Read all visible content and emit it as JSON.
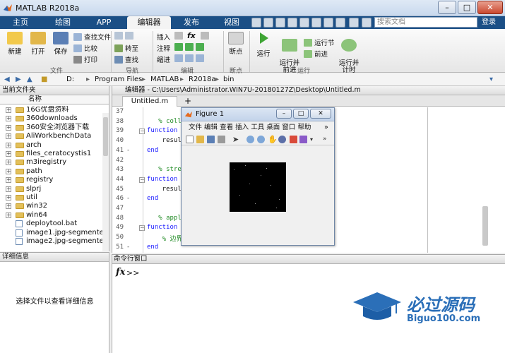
{
  "window": {
    "title": "MATLAB R2018a",
    "controls": [
      "–",
      "□",
      "✕"
    ]
  },
  "tabs": [
    {
      "label": "主页",
      "active": false
    },
    {
      "label": "绘图",
      "active": false
    },
    {
      "label": "APP",
      "active": false
    },
    {
      "label": "编辑器",
      "active": true
    },
    {
      "label": "发布",
      "active": false
    },
    {
      "label": "视图",
      "active": false
    }
  ],
  "search": {
    "placeholder": "搜索文档"
  },
  "login": "登录",
  "ribbon": {
    "file": {
      "new": "新建",
      "open": "打开",
      "save": "保存",
      "find_files": "查找文件",
      "compare": "比较",
      "print": "打印",
      "group": "文件"
    },
    "nav": {
      "goto": "转至",
      "find": "查找",
      "group": "导航"
    },
    "edit": {
      "insert": "插入",
      "comment": "注释",
      "indent": "缩进",
      "fx": "fx",
      "group": "编辑"
    },
    "breakpoints": {
      "label": "断点",
      "group": "断点"
    },
    "run": {
      "run": "运行",
      "run_advance": "运行并\n前进",
      "run_section": "运行节",
      "advance": "前进",
      "run_time": "运行并\n计时",
      "group": "运行"
    }
  },
  "address": {
    "path": [
      "D:",
      "Program Files",
      "MATLAB",
      "R2018a",
      "bin"
    ]
  },
  "file_browser": {
    "header": "当前文件夹",
    "column": "名称",
    "items": [
      {
        "name": "16G优盘资料",
        "type": "folder"
      },
      {
        "name": "360downloads",
        "type": "folder"
      },
      {
        "name": "360安全浏览器下载",
        "type": "folder"
      },
      {
        "name": "AliWorkbenchData",
        "type": "folder"
      },
      {
        "name": "arch",
        "type": "folder"
      },
      {
        "name": "files_ceratocystis1",
        "type": "folder"
      },
      {
        "name": "m3iregistry",
        "type": "folder"
      },
      {
        "name": "path",
        "type": "folder"
      },
      {
        "name": "registry",
        "type": "folder"
      },
      {
        "name": "slprj",
        "type": "folder"
      },
      {
        "name": "util",
        "type": "folder"
      },
      {
        "name": "win32",
        "type": "folder"
      },
      {
        "name": "win64",
        "type": "folder"
      },
      {
        "name": "deploytool.bat",
        "type": "file"
      },
      {
        "name": "image1.jpg-segmente...",
        "type": "file"
      },
      {
        "name": "image2.jpg-segmente...",
        "type": "file"
      }
    ]
  },
  "details": {
    "header": "详细信息",
    "empty_text": "选择文件以查看详细信息"
  },
  "editor": {
    "header": "编辑器 - C:\\Users\\Administrator.WIN7U-20180127Z\\Desktop\\Untitled.m",
    "tab": "Untitled.m",
    "add_tab": "+",
    "lines": [
      {
        "n": "37",
        "code": "",
        "kind": "plain"
      },
      {
        "n": "38",
        "code": "   % collide",
        "kind": "comment"
      },
      {
        "n": "39",
        "code": "function",
        "kind": "keyword"
      },
      {
        "n": "40",
        "code": "    resul",
        "kind": "plain"
      },
      {
        "n": "41",
        "code": "end",
        "kind": "keyword"
      },
      {
        "n": "42",
        "code": "",
        "kind": "plain"
      },
      {
        "n": "43",
        "code": "   % stream",
        "kind": "comment"
      },
      {
        "n": "44",
        "code": "function",
        "kind": "keyword"
      },
      {
        "n": "45",
        "code": "    resul",
        "kind": "plain"
      },
      {
        "n": "46",
        "code": "end",
        "kind": "keyword"
      },
      {
        "n": "47",
        "code": "",
        "kind": "plain"
      },
      {
        "n": "48",
        "code": "   % applyBo",
        "kind": "comment"
      },
      {
        "n": "49",
        "code": "function",
        "kind": "keyword"
      },
      {
        "n": "50",
        "code": "    % 边界",
        "kind": "comment"
      },
      {
        "n": "51",
        "code": "end",
        "kind": "keyword"
      }
    ]
  },
  "command_window": {
    "header": "命令行窗口",
    "prompt": ">>",
    "fx": "fx"
  },
  "figure": {
    "title": "Figure 1",
    "menu": [
      "文件",
      "编辑",
      "查看",
      "插入",
      "工具",
      "桌面",
      "窗口",
      "帮助"
    ],
    "more": "»"
  },
  "watermark": {
    "brand": "必过源码",
    "url": "Biguo100.com"
  }
}
